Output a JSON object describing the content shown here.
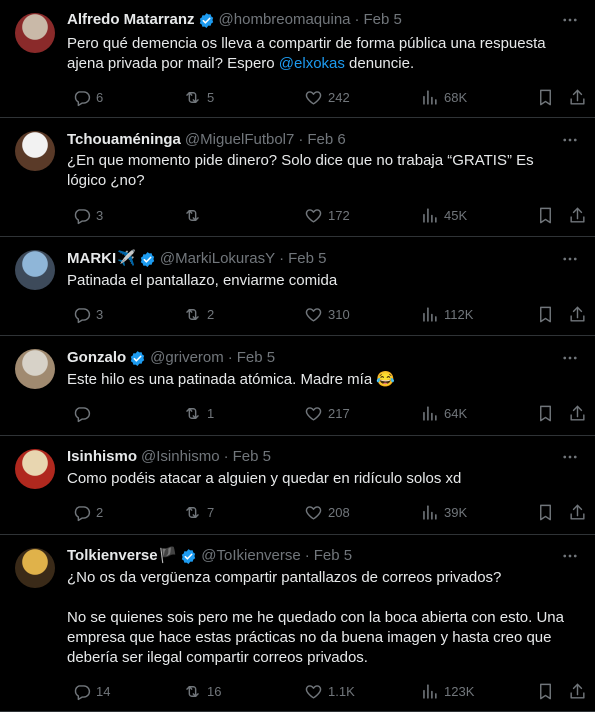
{
  "tweets": [
    {
      "name": "Alfredo Matarranz",
      "verified": true,
      "emoji": "",
      "handle": "@hombreomaquina",
      "date": "Feb 5",
      "text_before": "Pero qué demencia os lleva a compartir de forma pública una respuesta ajena privada por mail? Espero ",
      "mention": "@elxokas",
      "text_after": " denuncie.",
      "replies": "6",
      "retweets": "5",
      "likes": "242",
      "views": "68K",
      "avatar_colors": [
        "#c9b9a8",
        "#8a2a2a"
      ]
    },
    {
      "name": "Tchouaméninga",
      "verified": false,
      "emoji": "",
      "handle": "@MiguelFutbol7",
      "date": "Feb 6",
      "text_before": "¿En que momento pide dinero? Solo dice que no trabaja “GRATIS” Es lógico ¿no?",
      "mention": "",
      "text_after": "",
      "replies": "3",
      "retweets": "",
      "likes": "172",
      "views": "45K",
      "avatar_colors": [
        "#f2f2f2",
        "#5a3a28"
      ]
    },
    {
      "name": "MARKI",
      "verified": true,
      "emoji": "✈️",
      "handle": "@MarkiLokurasY",
      "date": "Feb 5",
      "text_before": "Patinada el pantallazo, enviarme comida",
      "mention": "",
      "text_after": "",
      "replies": "3",
      "retweets": "2",
      "likes": "310",
      "views": "112K",
      "avatar_colors": [
        "#8fb6d8",
        "#3d4a5a"
      ]
    },
    {
      "name": "Gonzalo",
      "verified": true,
      "emoji": "",
      "handle": "@griverom",
      "date": "Feb 5",
      "text_before": "Este hilo es una patinada atómica. Madre mía 😂",
      "mention": "",
      "text_after": "",
      "replies": "",
      "retweets": "1",
      "likes": "217",
      "views": "64K",
      "avatar_colors": [
        "#d7d2c8",
        "#a08a70"
      ]
    },
    {
      "name": "Isinhismo",
      "verified": false,
      "emoji": "",
      "handle": "@Isinhismo",
      "date": "Feb 5",
      "text_before": "Como podéis atacar a alguien y quedar en ridículo solos xd",
      "mention": "",
      "text_after": "",
      "replies": "2",
      "retweets": "7",
      "likes": "208",
      "views": "39K",
      "avatar_colors": [
        "#e8d6b0",
        "#b0281e"
      ]
    },
    {
      "name": "Tolkienverse",
      "verified": true,
      "emoji": "🏴",
      "handle": "@ToIkienverse",
      "date": "Feb 5",
      "text_before": "¿No os da vergüenza compartir pantallazos de correos privados?\n\nNo se quienes sois pero me he quedado con la boca abierta con esto. Una empresa que hace estas prácticas no da buena imagen y hasta creo que debería ser ilegal compartir correos privados.",
      "mention": "",
      "text_after": "",
      "replies": "14",
      "retweets": "16",
      "likes": "1.1K",
      "views": "123K",
      "avatar_colors": [
        "#e0b24a",
        "#3a2a18"
      ]
    }
  ],
  "colors": {
    "background": "#000000",
    "text": "#e7e9ea",
    "muted": "#71767b",
    "accent": "#1d9bf0",
    "divider": "#2f3336"
  },
  "icons": [
    "reply-icon",
    "retweet-icon",
    "like-icon",
    "views-icon",
    "bookmark-icon",
    "share-icon",
    "verified-badge-icon",
    "more-icon"
  ]
}
